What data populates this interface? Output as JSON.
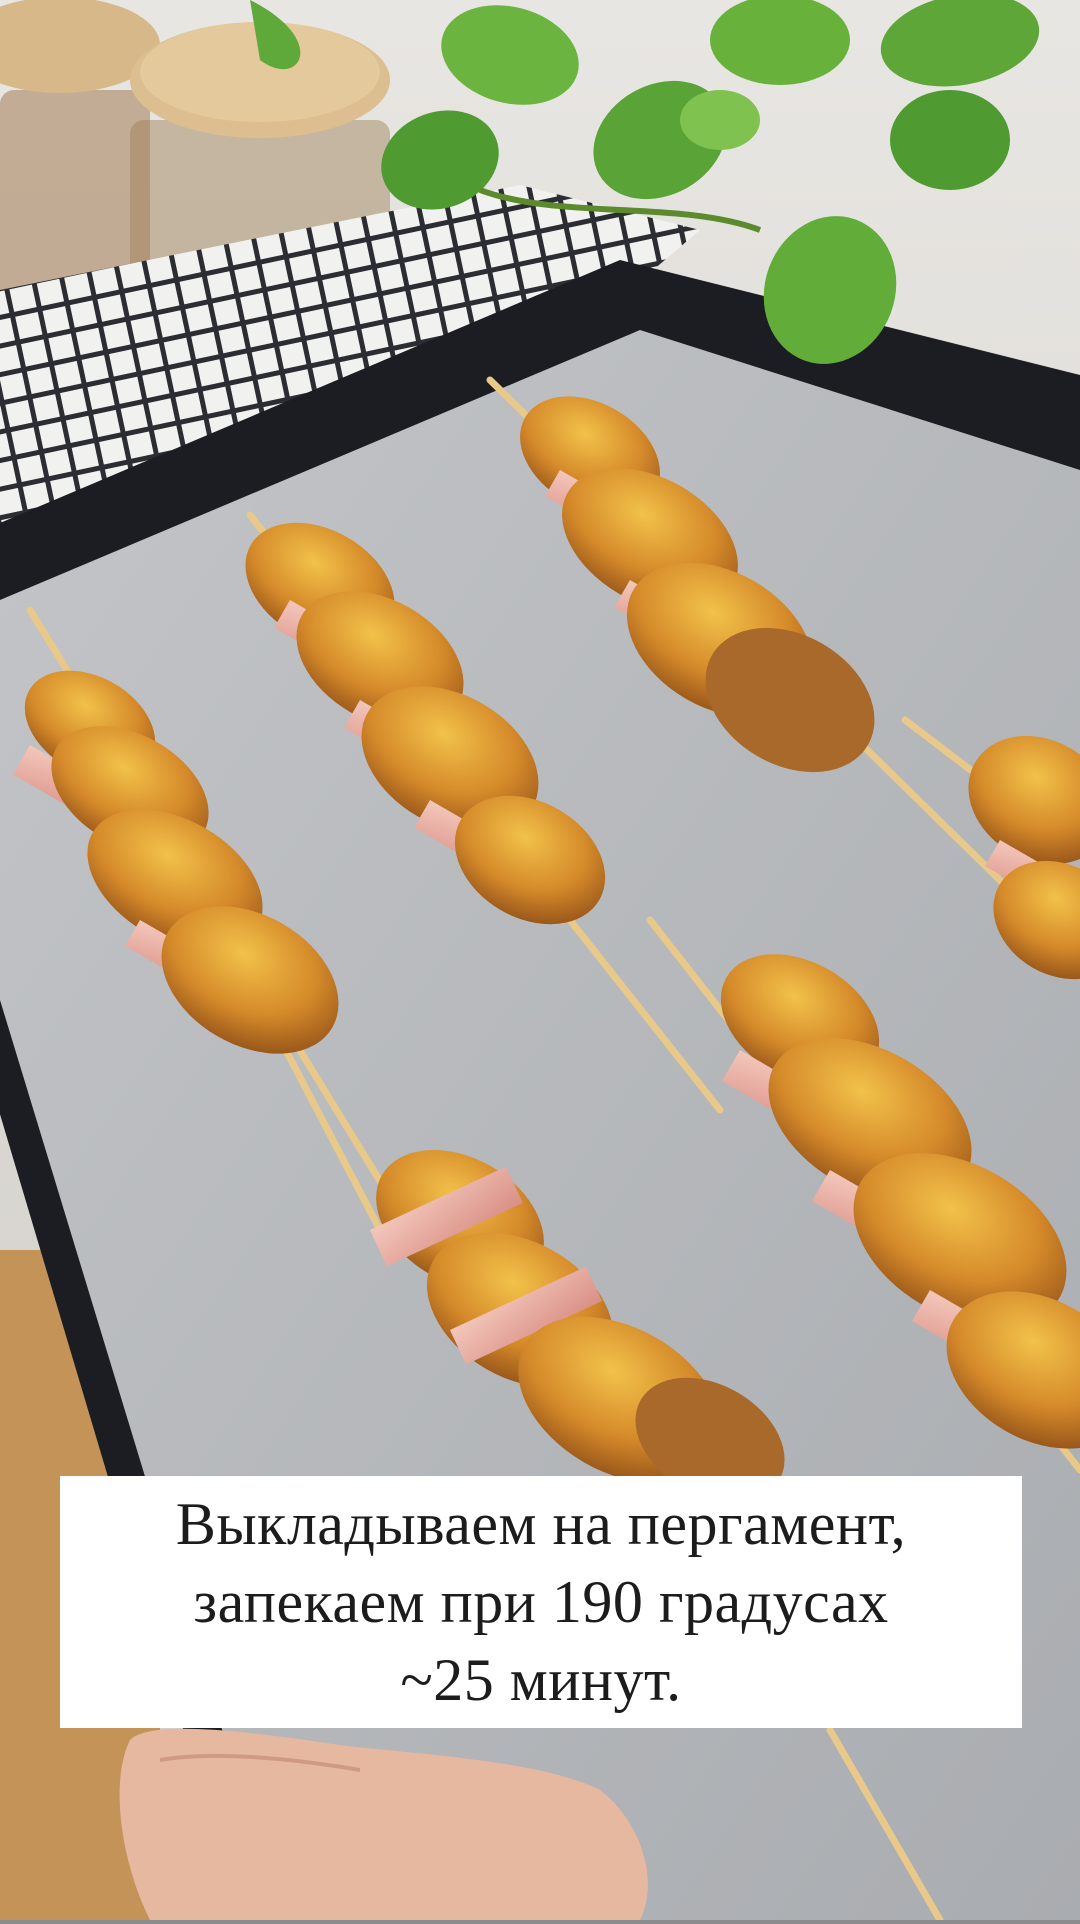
{
  "caption": {
    "line1": "Выкладываем на пергамент,",
    "line2": "запекаем при 190 градусах",
    "line3": "~25 минут."
  },
  "colors": {
    "parchment": "#b3b6ba",
    "tray": "#1c1d22",
    "potato": "#d9962f",
    "ham": "#e9b3a6",
    "leaf": "#5fa93a",
    "caption_bg": "#ffffff",
    "caption_text": "#1c1c1c"
  }
}
